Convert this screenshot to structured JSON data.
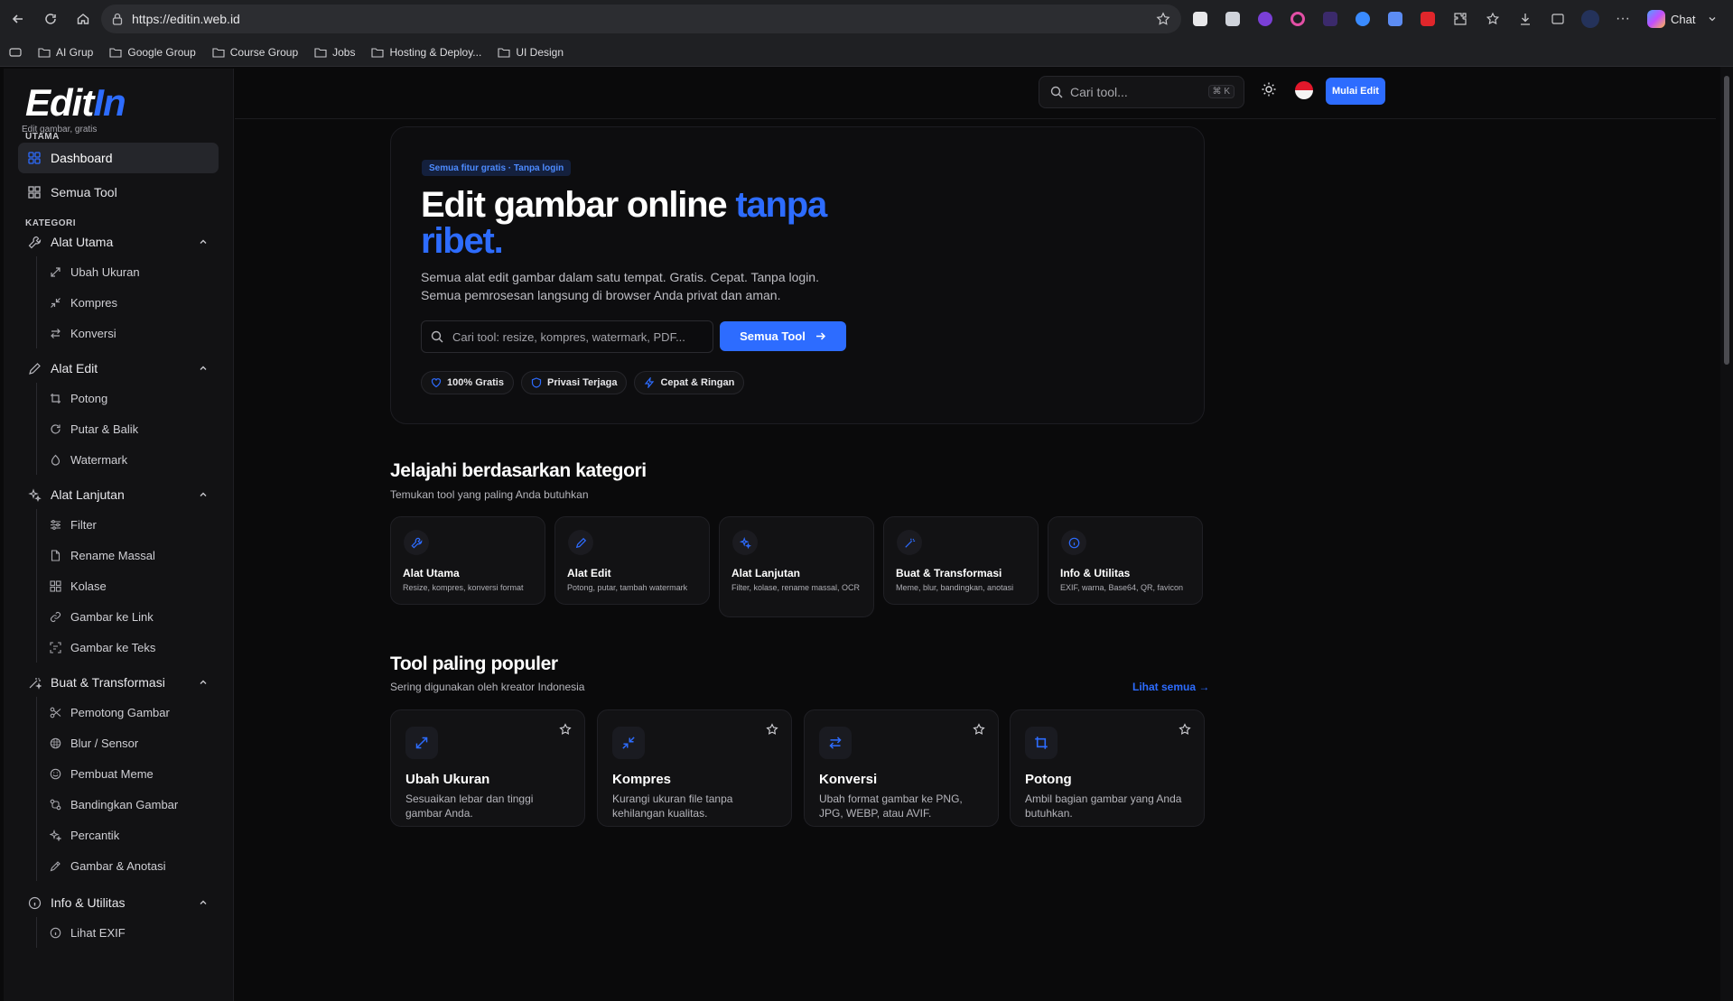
{
  "browser": {
    "url": "https://editin.web.id",
    "bookmarks": [
      "AI Grup",
      "Google Group",
      "Course Group",
      "Jobs",
      "Hosting & Deploy...",
      "UI Design"
    ],
    "chat_label": "Chat"
  },
  "brand": {
    "logo_main": "Edit",
    "logo_accent": "In",
    "tagline": "Edit gambar, gratis"
  },
  "sidebar": {
    "section_main": "UTAMA",
    "main_items": [
      {
        "label": "Dashboard",
        "icon": "grid-icon",
        "active": true
      },
      {
        "label": "Semua Tool",
        "icon": "apps-icon",
        "active": false
      }
    ],
    "section_category": "KATEGORI",
    "categories": [
      {
        "label": "Alat Utama",
        "icon": "wrench-icon",
        "items": [
          "Ubah Ukuran",
          "Kompres",
          "Konversi"
        ]
      },
      {
        "label": "Alat Edit",
        "icon": "pencil-icon",
        "items": [
          "Potong",
          "Putar & Balik",
          "Watermark"
        ]
      },
      {
        "label": "Alat Lanjutan",
        "icon": "sparkles-icon",
        "items": [
          "Filter",
          "Rename Massal",
          "Kolase",
          "Gambar ke Link",
          "Gambar ke Teks"
        ]
      },
      {
        "label": "Buat & Transformasi",
        "icon": "wand-icon",
        "items": [
          "Pemotong Gambar",
          "Blur / Sensor",
          "Pembuat Meme",
          "Bandingkan Gambar",
          "Percantik",
          "Gambar & Anotasi"
        ]
      },
      {
        "label": "Info & Utilitas",
        "icon": "info-icon",
        "items": [
          "Lihat EXIF"
        ]
      }
    ]
  },
  "topbar": {
    "search_placeholder": "Cari tool...",
    "shortcut": "⌘ K",
    "start_button": "Mulai Edit"
  },
  "hero": {
    "badge": "Semua fitur gratis · Tanpa login",
    "title_main": "Edit gambar online ",
    "title_accent": "tanpa ribet.",
    "description": "Semua alat edit gambar dalam satu tempat. Gratis. Cepat. Tanpa login. Semua pemrosesan langsung di browser Anda privat dan aman.",
    "search_placeholder": "Cari tool: resize, kompres, watermark, PDF...",
    "cta": "Semua Tool",
    "chips": [
      "100% Gratis",
      "Privasi Terjaga",
      "Cepat & Ringan"
    ]
  },
  "categories_section": {
    "title": "Jelajahi berdasarkan kategori",
    "subtitle": "Temukan tool yang paling Anda butuhkan",
    "cards": [
      {
        "title": "Alat Utama",
        "desc": "Resize, kompres, konversi format"
      },
      {
        "title": "Alat Edit",
        "desc": "Potong, putar, tambah watermark"
      },
      {
        "title": "Alat Lanjutan",
        "desc": "Filter, kolase, rename massal, OCR"
      },
      {
        "title": "Buat & Transformasi",
        "desc": "Meme, blur, bandingkan, anotasi"
      },
      {
        "title": "Info & Utilitas",
        "desc": "EXIF, warna, Base64, QR, favicon"
      }
    ]
  },
  "popular_section": {
    "title": "Tool paling populer",
    "subtitle": "Sering digunakan oleh kreator Indonesia",
    "see_all": "Lihat semua →",
    "cards": [
      {
        "title": "Ubah Ukuran",
        "desc": "Sesuaikan lebar dan tinggi gambar Anda."
      },
      {
        "title": "Kompres",
        "desc": "Kurangi ukuran file tanpa kehilangan kualitas."
      },
      {
        "title": "Konversi",
        "desc": "Ubah format gambar ke PNG, JPG, WEBP, atau AVIF."
      },
      {
        "title": "Potong",
        "desc": "Ambil bagian gambar yang Anda butuhkan."
      }
    ]
  },
  "colors": {
    "accent": "#2d6cff",
    "background": "#0a0a0b",
    "card": "#121214"
  }
}
